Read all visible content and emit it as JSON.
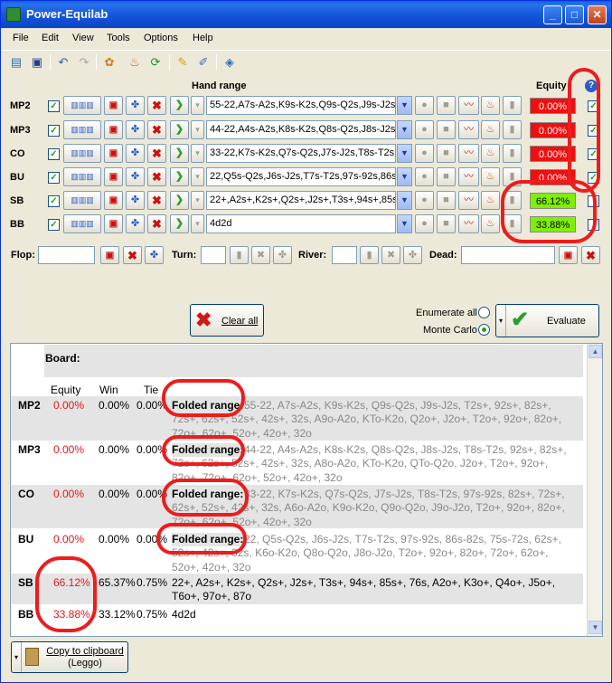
{
  "window": {
    "title": "Power-Equilab",
    "min": "_",
    "max": "□",
    "close": "✕"
  },
  "menu": [
    "File",
    "Edit",
    "View",
    "Tools",
    "Options",
    "Help"
  ],
  "toolbar_icons": [
    "new-icon",
    "save-icon",
    "undo-icon",
    "redo-icon",
    "settings-icon",
    "fire-icon",
    "refresh-icon",
    "pencil-icon",
    "pen-icon",
    "export-icon"
  ],
  "header": {
    "hand_range": "Hand range",
    "equity": "Equity",
    "help": "?"
  },
  "players": [
    {
      "name": "MP2",
      "checked": "✓",
      "range": "55-22,A7s-A2s,K9s-K2s,Q9s-Q2s,J9s-J2s,T2s+,92s+",
      "equity": "0.00%",
      "right_checked": "✓"
    },
    {
      "name": "MP3",
      "checked": "✓",
      "range": "44-22,A4s-A2s,K8s-K2s,Q8s-Q2s,J8s-J2s,T8s-T2s",
      "equity": "0.00%",
      "right_checked": "✓"
    },
    {
      "name": "CO",
      "checked": "✓",
      "range": "33-22,K7s-K2s,Q7s-Q2s,J7s-J2s,T8s-T2s,97s-92s",
      "equity": "0.00%",
      "right_checked": "✓"
    },
    {
      "name": "BU",
      "checked": "✓",
      "range": "22,Q5s-Q2s,J6s-J2s,T7s-T2s,97s-92s,86s-82s",
      "equity": "0.00%",
      "right_checked": "✓"
    },
    {
      "name": "SB",
      "checked": "✓",
      "range": "22+,A2s+,K2s+,Q2s+,J2s+,T3s+,94s+,85s+",
      "equity": "66.12%",
      "right_checked": ""
    },
    {
      "name": "BB",
      "checked": "✓",
      "range": "4d2d",
      "equity": "33.88%",
      "right_checked": ""
    }
  ],
  "board": {
    "flop": "Flop:",
    "turn": "Turn:",
    "river": "River:",
    "dead": "Dead:"
  },
  "buttons": {
    "clear_all": "Clear all",
    "evaluate": "Evaluate",
    "copy_line1": "Copy to clipboard",
    "copy_line2": "(Leggo)"
  },
  "mode": {
    "enumerate": "Enumerate all",
    "monte_carlo": "Monte Carlo"
  },
  "results": {
    "board_label": "Board:",
    "cols": {
      "equity": "Equity",
      "win": "Win",
      "tie": "Tie"
    },
    "rows": [
      {
        "name": "MP2",
        "equity": "0.00%",
        "win": "0.00%",
        "tie": "0.00%",
        "folded": "Folded range:",
        "range": "55-22, A7s-A2s, K9s-K2s, Q9s-Q2s, J9s-J2s, T2s+, 92s+, 82s+, 72s+, 62s+, 52s+, 42s+, 32s, A9o-A2o, KTo-K2o, Q2o+, J2o+, T2o+, 92o+, 82o+, 72o+, 62o+, 52o+, 42o+, 32o"
      },
      {
        "name": "MP3",
        "equity": "0.00%",
        "win": "0.00%",
        "tie": "0.00%",
        "folded": "Folded range:",
        "range": "44-22, A4s-A2s, K8s-K2s, Q8s-Q2s, J8s-J2s, T8s-T2s, 92s+, 82s+, 72s+, 62s+, 52s+, 42s+, 32s, A8o-A2o, KTo-K2o, QTo-Q2o, J2o+, T2o+, 92o+, 82o+, 72o+, 62o+, 52o+, 42o+, 32o"
      },
      {
        "name": "CO",
        "equity": "0.00%",
        "win": "0.00%",
        "tie": "0.00%",
        "folded": "Folded range:",
        "range": "33-22, K7s-K2s, Q7s-Q2s, J7s-J2s, T8s-T2s, 97s-92s, 82s+, 72s+, 62s+, 52s+, 42s+, 32s, A6o-A2o, K9o-K2o, Q9o-Q2o, J9o-J2o, T2o+, 92o+, 82o+, 72o+, 62o+, 52o+, 42o+, 32o"
      },
      {
        "name": "BU",
        "equity": "0.00%",
        "win": "0.00%",
        "tie": "0.00%",
        "folded": "Folded range:",
        "range": "22, Q5s-Q2s, J6s-J2s, T7s-T2s, 97s-92s, 86s-82s, 75s-72s, 62s+, 52s+, 42s+, 32s, K6o-K2o, Q8o-Q2o, J8o-J2o, T2o+, 92o+, 82o+, 72o+, 62o+, 52o+, 42o+, 32o"
      },
      {
        "name": "SB",
        "equity": "66.12%",
        "win": "65.37%",
        "tie": "0.75%",
        "folded": "",
        "range": "22+, A2s+, K2s+, Q2s+, J2s+, T3s+, 94s+, 85s+, 76s, A2o+, K3o+, Q4o+, J5o+, T6o+, 97o+, 87o"
      },
      {
        "name": "BB",
        "equity": "33.88%",
        "win": "33.12%",
        "tie": "0.75%",
        "folded": "",
        "range": "4d2d"
      }
    ]
  },
  "colors": {
    "annotation": "#ee1c1c",
    "equity_zero": "#ee1010",
    "equity_pos": "#7ff000"
  }
}
